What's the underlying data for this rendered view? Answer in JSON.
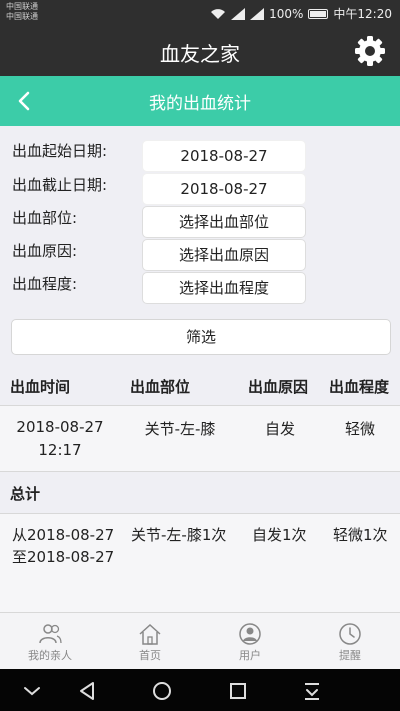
{
  "status_bar": {
    "carrier_1": "中国联通",
    "carrier_2": "中国联通",
    "battery": "100%",
    "time": "中午12:20"
  },
  "app": {
    "title": "血友之家"
  },
  "page": {
    "title": "我的出血统计"
  },
  "filter": {
    "start_date_label": "出血起始日期:",
    "start_date_value": "2018-08-27",
    "end_date_label": "出血截止日期:",
    "end_date_value": "2018-08-27",
    "site_label": "出血部位:",
    "site_value": "选择出血部位",
    "cause_label": "出血原因:",
    "cause_value": "选择出血原因",
    "severity_label": "出血程度:",
    "severity_value": "选择出血程度",
    "submit_label": "筛选"
  },
  "table": {
    "headers": [
      "出血时间",
      "出血部位",
      "出血原因",
      "出血程度"
    ],
    "rows": [
      {
        "date": "2018-08-27",
        "time": "12:17",
        "site": "关节-左-膝",
        "cause": "自发",
        "severity": "轻微"
      }
    ]
  },
  "summary": {
    "title": "总计",
    "range_from": "从2018-08-27",
    "range_to": "至2018-08-27",
    "site_count": "关节-左-膝1次",
    "cause_count": "自发1次",
    "severity_count": "轻微1次"
  },
  "tabs": [
    {
      "label": "我的亲人",
      "icon": "people-icon"
    },
    {
      "label": "首页",
      "icon": "home-icon"
    },
    {
      "label": "用户",
      "icon": "user-icon"
    },
    {
      "label": "提醒",
      "icon": "clock-icon"
    }
  ],
  "colors": {
    "header_bg": "#2f2f2f",
    "accent": "#3ccca8",
    "nav_bg": "#050505"
  }
}
